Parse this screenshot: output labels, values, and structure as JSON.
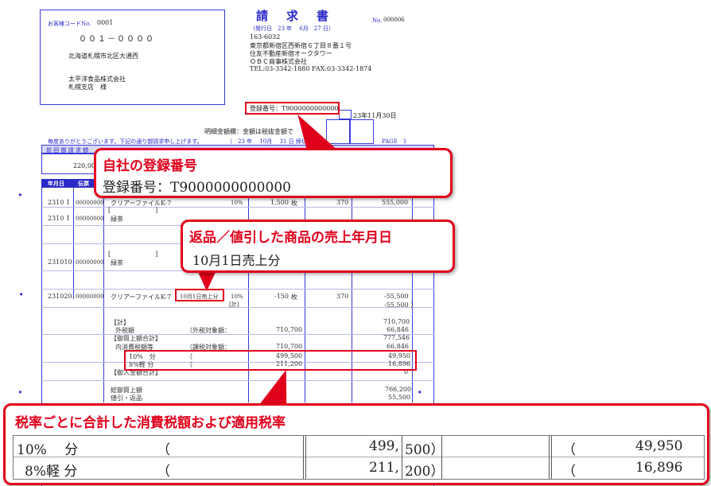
{
  "invoice": {
    "title": "請　求　書",
    "number_label": "No.",
    "number": "000006",
    "issue_date": "（発行日　23 年　 6月　27 日）",
    "customer_code_label": "お客様コードNo.",
    "customer_code": "0001",
    "postal_code": "００１－００００",
    "customer_address": "北海道札幌市北区大通西",
    "customer_company": "太平洋食品株式会社",
    "customer_branch": "札幌支店　様",
    "issuer_postal": "163-6032",
    "issuer_address1": "東京都新宿区西新宿６丁目８番１号",
    "issuer_address2": "住友不動産新宿オークタワー",
    "issuer_company": "ＯＢＣ商事株式会社",
    "issuer_phone": "TEL:03-3342-1880 FAX:03-3342-1874",
    "registration_number": "登録番号：T9000000000000",
    "closing_date": "23年11月30日",
    "detail_note": "明細金額欄：金額は税抜金額で",
    "greeting": "毎度ありがとうございます。下記の通り御請求申し上げます。",
    "period": "（　23 年　 10月　 31 日 締切",
    "page_label": "PAGE　1",
    "prev_balance_label": "前 回 御 請 求 額",
    "prev_balance": "220,000",
    "col_date": "年月日",
    "col_slip": "伝票",
    "rows": [
      {
        "date": "2310 1",
        "slip": "00000000",
        "item": "クリアーファイルK-7",
        "tax": "10%",
        "qty": "1,500",
        "unit": "枚",
        "price": "370",
        "amount": "555,000"
      },
      {
        "date": "2310 1",
        "slip": "00000000",
        "item": "緑茶",
        "bracket": "[　　　　　　　]"
      },
      {
        "date": "231010",
        "slip": "00000000",
        "item": "緑茶",
        "bracket": "[　　　　　　　]"
      },
      {
        "date": "231020",
        "slip": "00000000",
        "item": "クリアーファイルK-7",
        "tax": "10%",
        "qty": "-150",
        "unit": "枚",
        "price": "370",
        "amount": "-55,500",
        "amount2": "-55,500 ）",
        "sale_date_note": "10月1日売上分",
        "subtotal_label": "[計]"
      }
    ],
    "summary": [
      {
        "label": "【計】",
        "value": "710,700"
      },
      {
        "label": "外税額",
        "label2": "（外税対象額：",
        "mid": "710,700",
        "value": "66,846"
      },
      {
        "label": "【御買上額合計】",
        "value": "777,546"
      },
      {
        "label": "内消費税額等",
        "label2": "（課税対象額：",
        "mid": "710,700",
        "value": "66,846"
      },
      {
        "label": "10%　分",
        "label2": "（",
        "mid": "499,500",
        "value": "49,950"
      },
      {
        "label": "8%軽 分",
        "label2": "（",
        "mid": "211,200",
        "value": "16,896"
      },
      {
        "label": "【御入金額合計】",
        "value": "0"
      },
      {
        "label": "総御買上額",
        "value": "766,200"
      },
      {
        "label": "値引・返品",
        "value": "55,500"
      }
    ]
  },
  "callouts": {
    "registration": {
      "title": "自社の登録番号",
      "body": "登録番号：T9000000000000"
    },
    "return_date": {
      "title": "返品／値引した商品の売上年月日",
      "body": "10月1日売上分"
    },
    "tax_rate": {
      "title": "税率ごとに合計した消費税額および適用税率",
      "row1": {
        "label": "10%　 分",
        "paren": "（",
        "amount": "499,",
        "amount_b": "500）",
        "paren2": "（",
        "tax": "49,950"
      },
      "row2": {
        "label": "8%軽 分",
        "paren": "（",
        "amount": "211,",
        "amount_b": "200）",
        "paren2": "（",
        "tax": "16,896"
      }
    }
  },
  "colors": {
    "accent_red": "#e0001b",
    "invoice_blue": "#2a2ac8"
  }
}
